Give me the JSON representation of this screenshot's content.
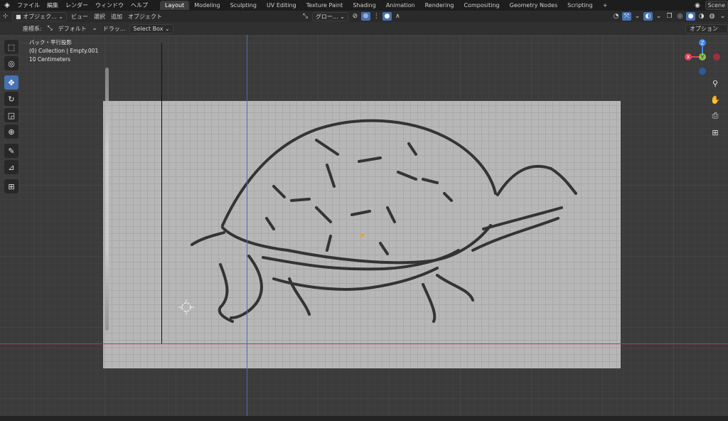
{
  "topbar": {
    "logo_icon": "blender-logo-icon",
    "menus": [
      "ファイル",
      "編集",
      "レンダー",
      "ウィンドウ",
      "ヘルプ"
    ],
    "workspaces": [
      "Layout",
      "Modeling",
      "Sculpting",
      "UV Editing",
      "Texture Paint",
      "Shading",
      "Animation",
      "Rendering",
      "Compositing",
      "Geometry Nodes",
      "Scripting",
      "+"
    ],
    "active_workspace": "Layout",
    "scene_label": "Scene"
  },
  "header": {
    "mode": "オブジェク...",
    "menus": [
      "ビュー",
      "選択",
      "追加",
      "オブジェクト"
    ],
    "transform_orientation": "グロー...",
    "options_label": "オプション"
  },
  "tool_header": {
    "orientation_label": "座標系:",
    "orientation_value": "デフォルト",
    "drag_label": "ドラッ...",
    "drag_value": "Select Box"
  },
  "viewport_info": {
    "view": "バック・平行投影",
    "collection": "(0) Collection | Empty.001",
    "scale": "10 Centimeters"
  },
  "gizmo": {
    "x": "X",
    "y": "Y",
    "z": "Z",
    "x_color": "#e0425c",
    "y_color": "#8bc24a",
    "z_color": "#3f86e8"
  },
  "toolbar": [
    "select-box-icon",
    "cursor-icon",
    "move-icon",
    "rotate-icon",
    "scale-icon",
    "transform-icon",
    "annotate-icon",
    "measure-icon",
    "add-cube-icon"
  ],
  "nav_icons": [
    "zoom-icon",
    "hand-icon",
    "camera-icon",
    "grid-icon"
  ],
  "colors": {
    "accent": "#4772b3",
    "axis_x": "#b1414a",
    "axis_y": "#4b6db3"
  }
}
